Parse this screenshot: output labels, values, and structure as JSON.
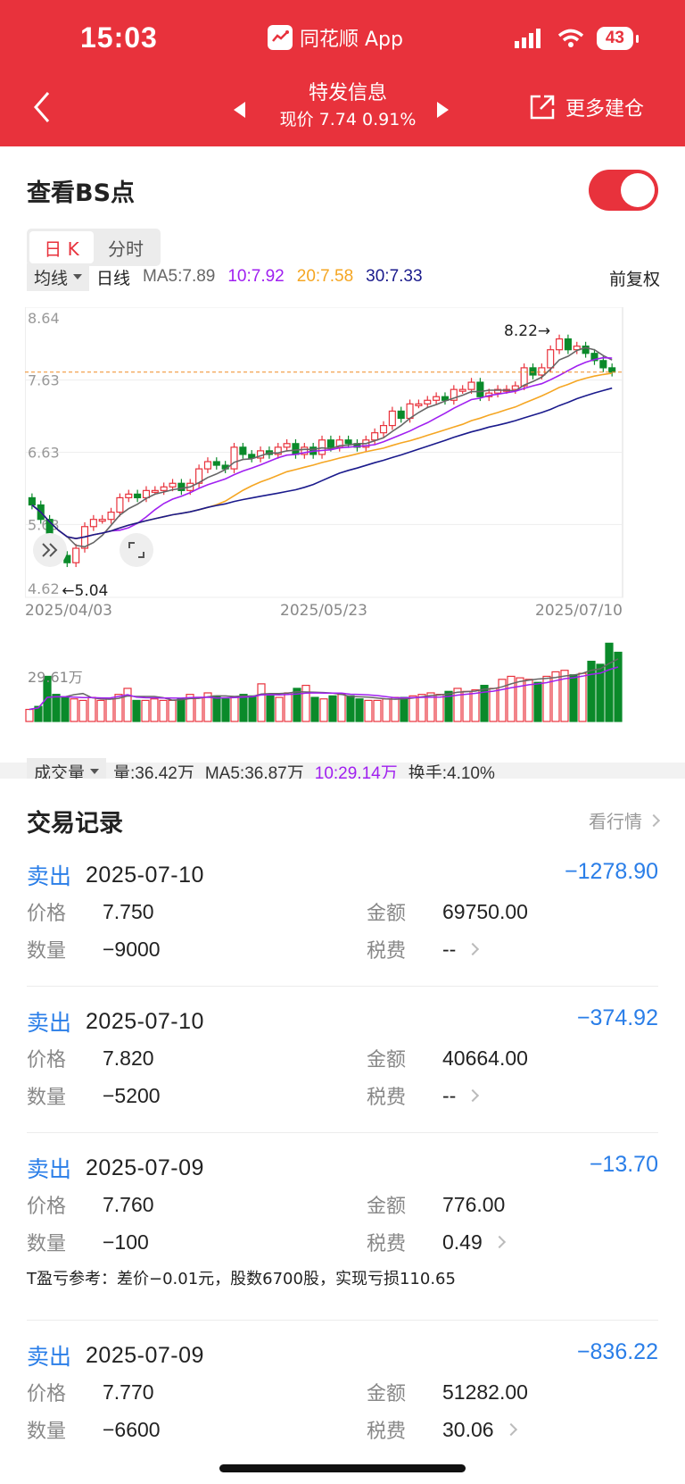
{
  "status": {
    "time": "15:03",
    "app_name": "同花顺 App",
    "battery": "43"
  },
  "nav": {
    "title": "特发信息",
    "subtitle": "现价 7.74 0.91%",
    "more": "更多建仓"
  },
  "bs": {
    "title": "查看BS点",
    "tabs": [
      "日 K",
      "分时"
    ],
    "active_tab": "日 K"
  },
  "legend": {
    "indicator": "均线",
    "period": "日线",
    "ma5": "MA5:7.89",
    "ma10": "10:7.92",
    "ma20": "20:7.58",
    "ma30": "30:7.33",
    "adjust": "前复权",
    "colors": {
      "ma5": "#666666",
      "ma10": "#a020f0",
      "ma20": "#f5a623",
      "ma30": "#1a1a8c"
    }
  },
  "chart_labels": {
    "y_ticks": [
      "8.64",
      "7.63",
      "6.63",
      "5.63",
      "4.62"
    ],
    "x_ticks": [
      "2025/04/03",
      "2025/05/23",
      "2025/07/10"
    ],
    "high_marker": "8.22→",
    "low_marker": "←5.04",
    "ref_price": "7.74"
  },
  "volume": {
    "indicator": "成交量",
    "vol": "量:36.42万",
    "ma5": "MA5:36.87万",
    "ma10": "10:29.14万",
    "turnover": "换手:4.10%",
    "y_tick": "29.61万"
  },
  "records_section": {
    "title": "交易记录",
    "more": "看行情"
  },
  "labels": {
    "price": "价格",
    "qty": "数量",
    "amount": "金额",
    "fee": "税费"
  },
  "records": [
    {
      "type": "卖出",
      "date": "2025-07-10",
      "pnl": "−1278.90",
      "price": "7.750",
      "qty": "−9000",
      "amount": "69750.00",
      "fee": "--"
    },
    {
      "type": "卖出",
      "date": "2025-07-10",
      "pnl": "−374.92",
      "price": "7.820",
      "qty": "−5200",
      "amount": "40664.00",
      "fee": "--"
    },
    {
      "type": "卖出",
      "date": "2025-07-09",
      "pnl": "−13.70",
      "price": "7.760",
      "qty": "−100",
      "amount": "776.00",
      "fee": "0.49",
      "note": "T盈亏参考：差价−0.01元，股数6700股，实现亏损110.65"
    },
    {
      "type": "卖出",
      "date": "2025-07-09",
      "pnl": "−836.22",
      "price": "7.770",
      "qty": "−6600",
      "amount": "51282.00",
      "fee": "30.06"
    }
  ],
  "chart_data": [
    {
      "type": "candlestick",
      "title": "",
      "x_range": [
        "2025/04/03",
        "2025/07/10"
      ],
      "ylim": [
        4.62,
        8.64
      ],
      "close": [
        5.9,
        5.7,
        5.4,
        5.2,
        5.1,
        5.3,
        5.6,
        5.7,
        5.7,
        5.8,
        6.0,
        6.05,
        6.0,
        6.1,
        6.1,
        6.15,
        6.2,
        6.1,
        6.2,
        6.4,
        6.5,
        6.45,
        6.4,
        6.7,
        6.6,
        6.55,
        6.65,
        6.6,
        6.7,
        6.75,
        6.6,
        6.7,
        6.6,
        6.8,
        6.7,
        6.8,
        6.75,
        6.7,
        6.8,
        6.9,
        7.0,
        7.2,
        7.1,
        7.3,
        7.3,
        7.35,
        7.4,
        7.35,
        7.5,
        7.5,
        7.6,
        7.4,
        7.45,
        7.5,
        7.5,
        7.55,
        7.8,
        7.7,
        7.8,
        8.05,
        8.2,
        8.05,
        8.1,
        8.0,
        7.9,
        7.8,
        7.74
      ],
      "ma_lines": [
        "MA5",
        "MA10",
        "MA20",
        "MA30"
      ],
      "annotations": {
        "high": 8.22,
        "low": 5.04
      }
    },
    {
      "type": "bar",
      "title": "",
      "ylabel": "成交量",
      "y_tick": "29.61万",
      "values": [
        8,
        10,
        30,
        18,
        16,
        15,
        14,
        16,
        14,
        15,
        18,
        22,
        14,
        14,
        15,
        14,
        14,
        15,
        18,
        16,
        19,
        17,
        15,
        16,
        18,
        17,
        25,
        17,
        16,
        19,
        22,
        24,
        16,
        15,
        17,
        18,
        17,
        15,
        14,
        14,
        15,
        16,
        16,
        17,
        18,
        19,
        18,
        20,
        22,
        20,
        21,
        24,
        22,
        28,
        30,
        29,
        28,
        26,
        30,
        33,
        34,
        31,
        32,
        40,
        38,
        52,
        46
      ]
    }
  ]
}
